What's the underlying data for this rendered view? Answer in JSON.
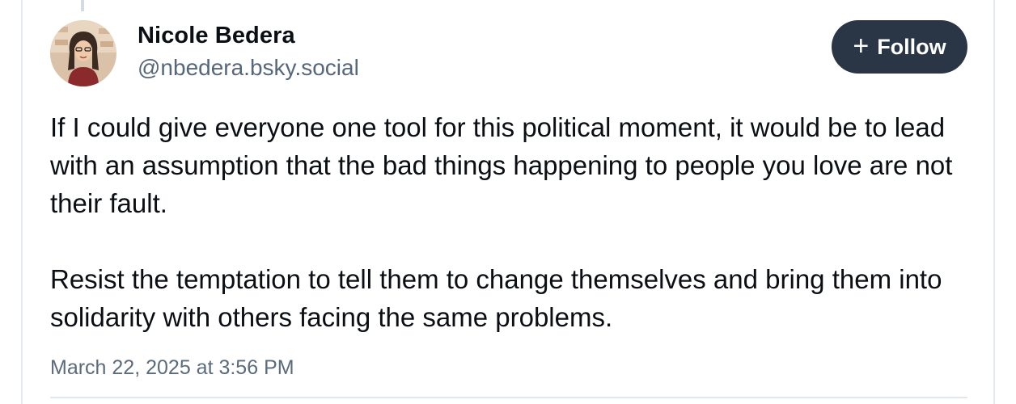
{
  "post": {
    "author": {
      "display_name": "Nicole Bedera",
      "handle": "@nbedera.bsky.social",
      "avatar_icon": "user-avatar-photo"
    },
    "follow_button": {
      "icon": "plus-icon",
      "label": "Follow",
      "background": "#2a3645",
      "text_color": "#ffffff"
    },
    "paragraphs": [
      "If I could give everyone one tool for this political moment, it would be to lead with an assumption that the bad things happening to people you love are not their fault.",
      "Resist the temptation to tell them to change themselves and bring them into solidarity with others facing the same problems."
    ],
    "timestamp": "March 22, 2025 at 3:56 PM"
  },
  "colors": {
    "text_primary": "#0b0f14",
    "text_secondary": "#56677a",
    "border": "#e6ebf0"
  }
}
